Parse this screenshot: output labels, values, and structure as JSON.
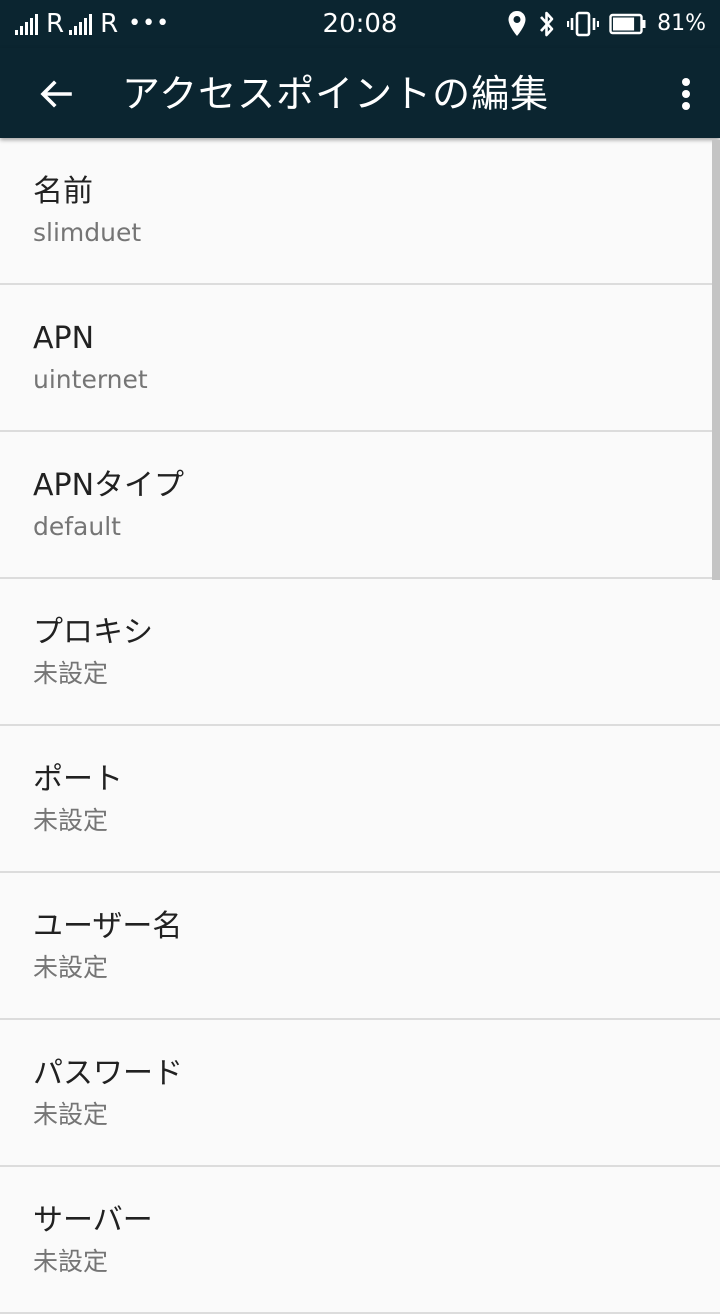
{
  "status_bar": {
    "signal1_label": "R",
    "signal2_label": "R",
    "more_label": "•••",
    "time": "20:08",
    "battery_percent": "81%",
    "battery_level": 0.81,
    "icons": [
      "signal-icon",
      "signal-icon",
      "more-notifications-icon",
      "location-icon",
      "bluetooth-icon",
      "vibrate-icon",
      "battery-icon"
    ]
  },
  "toolbar": {
    "title": "アクセスポイントの編集",
    "back_icon": "arrow-left-icon",
    "overflow_icon": "more-vert-icon"
  },
  "settings": [
    {
      "title": "名前",
      "summary": "slimduet"
    },
    {
      "title": "APN",
      "summary": "uinternet"
    },
    {
      "title": "APNタイプ",
      "summary": "default"
    },
    {
      "title": "プロキシ",
      "summary": "未設定"
    },
    {
      "title": "ポート",
      "summary": "未設定"
    },
    {
      "title": "ユーザー名",
      "summary": "未設定"
    },
    {
      "title": "パスワード",
      "summary": "未設定"
    },
    {
      "title": "サーバー",
      "summary": "未設定"
    }
  ],
  "colors": {
    "toolbar_bg": "#0b2530",
    "list_bg": "#fafafa",
    "title_text": "#212121",
    "summary_text": "#757575",
    "divider": "#dcdcdc"
  }
}
